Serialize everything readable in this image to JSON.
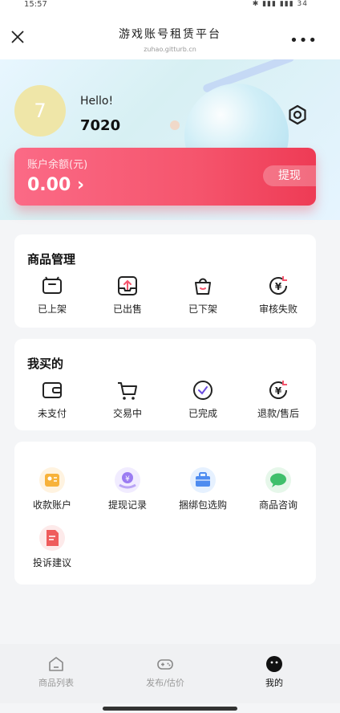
{
  "status": {
    "time": "15:57",
    "icons": "✱ ▮▮▮ ▮▮▮ 34"
  },
  "titlebar": {
    "title": "游戏账号租赁平台",
    "url": "zuhao.gitturb.cn"
  },
  "profile": {
    "avatar_text": "7",
    "greeting": "Hello!",
    "username": "7020"
  },
  "balance": {
    "label": "账户余额(元)",
    "amount": "0.00 ›",
    "withdraw_label": "提现"
  },
  "goods": {
    "title": "商品管理",
    "items": [
      {
        "label": "已上架",
        "icon": "shelf-up-icon"
      },
      {
        "label": "已出售",
        "icon": "sold-icon"
      },
      {
        "label": "已下架",
        "icon": "shelf-down-icon"
      },
      {
        "label": "审核失败",
        "icon": "review-failed-icon"
      }
    ]
  },
  "purchases": {
    "title": "我买的",
    "items": [
      {
        "label": "未支付",
        "icon": "wallet-icon"
      },
      {
        "label": "交易中",
        "icon": "cart-icon"
      },
      {
        "label": "已完成",
        "icon": "check-circle-icon"
      },
      {
        "label": "退款/售后",
        "icon": "refund-icon"
      }
    ]
  },
  "services": {
    "items": [
      {
        "label": "收款账户",
        "icon": "account-card-icon"
      },
      {
        "label": "提现记录",
        "icon": "withdraw-record-icon"
      },
      {
        "label": "捆绑包选购",
        "icon": "bundle-icon"
      },
      {
        "label": "商品咨询",
        "icon": "chat-icon"
      },
      {
        "label": "投诉建议",
        "icon": "complaint-icon"
      }
    ]
  },
  "tabbar": {
    "items": [
      {
        "label": "商品列表",
        "icon": "home-icon"
      },
      {
        "label": "发布/估价",
        "icon": "gamepad-icon"
      },
      {
        "label": "我的",
        "icon": "profile-icon"
      }
    ]
  },
  "colors": {
    "accent": "#f5556d",
    "balance_start": "#fb6a86",
    "balance_end": "#ee3b55"
  }
}
